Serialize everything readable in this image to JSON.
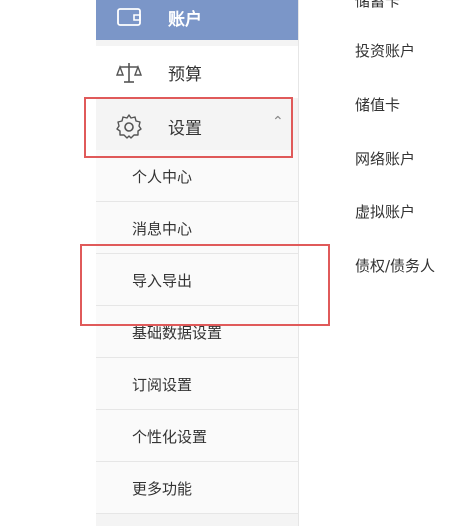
{
  "sidebar": {
    "account_label": "账户",
    "budget_label": "预算",
    "settings_label": "设置",
    "settings_expanded_icon": "chevron-up-icon",
    "submenu": [
      "个人中心",
      "消息中心",
      "导入导出",
      "基础数据设置",
      "订阅设置",
      "个性化设置",
      "更多功能"
    ]
  },
  "account_types": [
    "储蓄卡",
    "投资账户",
    "储值卡",
    "网络账户",
    "虚拟账户",
    "债权/债务人"
  ],
  "colors": {
    "account_bg": "#7b96c8",
    "sidebar_bg": "#f4f4f4",
    "highlight_box": "#e05a5a"
  }
}
